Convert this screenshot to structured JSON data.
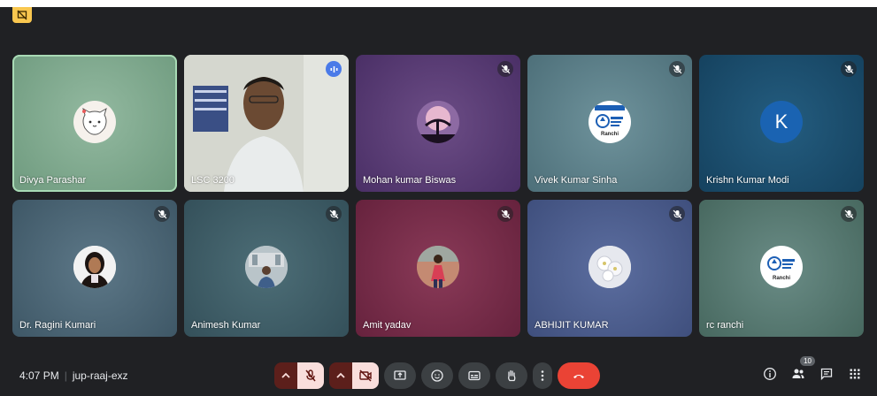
{
  "meeting": {
    "time": "4:07 PM",
    "code": "jup-raaj-exz"
  },
  "participants_count": "10",
  "tiles": [
    {
      "name": "Divya Parashar",
      "bg": "#7fa68d",
      "active": true,
      "mic": "none",
      "avatar": "cat-cartoon",
      "avatar_bg": "#f6f1ec"
    },
    {
      "name": "LSC 3200",
      "bg": "#cfd2c9",
      "mic": "speaking",
      "avatar": "camera-video"
    },
    {
      "name": "Mohan kumar Biswas",
      "bg": "#5d3b7a",
      "mic": "muted",
      "avatar": "tree-moon-photo",
      "avatar_bg": "#7c5d8e"
    },
    {
      "name": "Vivek Kumar Sinha",
      "bg": "#5a7f89",
      "mic": "muted",
      "avatar": "ignou-logo",
      "avatar_bg": "#ffffff"
    },
    {
      "name": "Krishn Kumar Modi",
      "bg": "#1f4f70",
      "mic": "muted",
      "avatar_letter": "K",
      "avatar_bg": "#1a63b2"
    },
    {
      "name": "Dr. Ragini Kumari",
      "bg": "#4b6575",
      "mic": "muted",
      "avatar": "person-photo",
      "avatar_bg": "#ffffff"
    },
    {
      "name": "Animesh Kumar",
      "bg": "#3e5e66",
      "mic": "muted",
      "avatar": "person-photo",
      "avatar_bg": "#a7b3b9"
    },
    {
      "name": "Amit yadav",
      "bg": "#7a2e4a",
      "mic": "muted",
      "avatar": "person-photo",
      "avatar_bg": "#9b6b76"
    },
    {
      "name": "ABHIJIT KUMAR",
      "bg": "#4b5c8c",
      "mic": "muted",
      "avatar": "flowers-photo",
      "avatar_bg": "#e8e8ec"
    },
    {
      "name": "rc ranchi",
      "bg": "#4f726c",
      "mic": "muted",
      "avatar": "ignou-logo",
      "avatar_bg": "#ffffff"
    }
  ],
  "avatar_caption": "Ranchi"
}
